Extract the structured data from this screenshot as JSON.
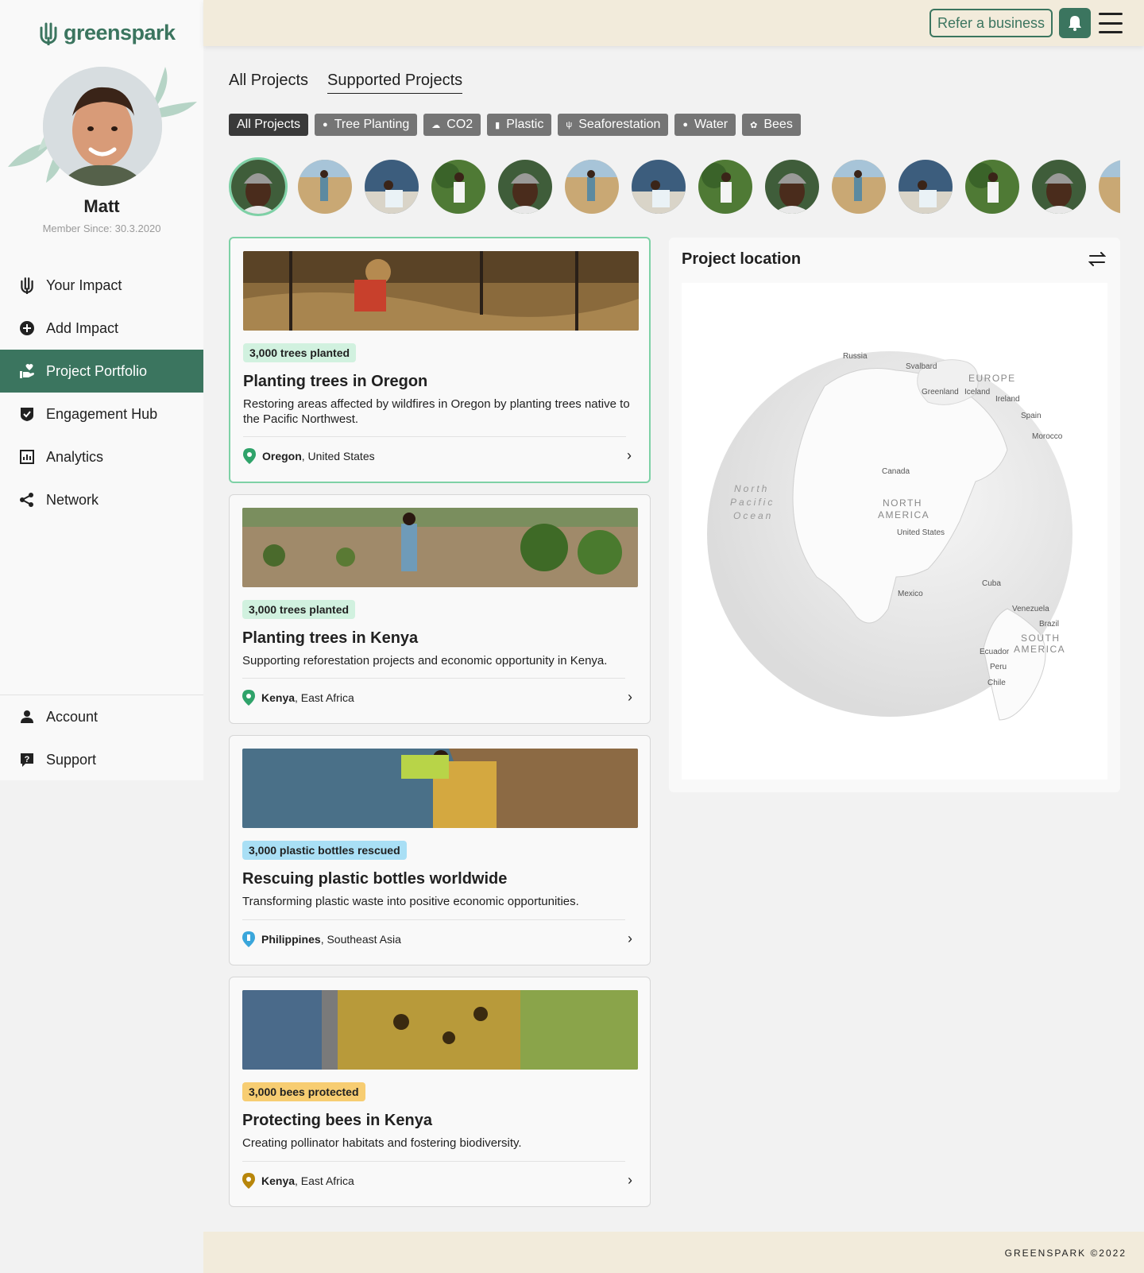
{
  "brand": {
    "name": "greenspark"
  },
  "user": {
    "name": "Matt",
    "member_since": "Member Since: 30.3.2020"
  },
  "nav": {
    "items": [
      {
        "label": "Your Impact",
        "icon": "hand-leaf-icon"
      },
      {
        "label": "Add Impact",
        "icon": "plus-circle-icon"
      },
      {
        "label": "Project Portfolio",
        "icon": "hand-heart-icon",
        "active": true
      },
      {
        "label": "Engagement Hub",
        "icon": "shield-check-icon"
      },
      {
        "label": "Analytics",
        "icon": "bar-chart-icon"
      },
      {
        "label": "Network",
        "icon": "share-icon"
      }
    ],
    "bottom": [
      {
        "label": "Account",
        "icon": "person-icon"
      },
      {
        "label": "Support",
        "icon": "help-icon"
      }
    ]
  },
  "header": {
    "refer_label": "Refer a business"
  },
  "tabs": [
    {
      "label": "All Projects",
      "active": false
    },
    {
      "label": "Supported Projects",
      "active": true
    }
  ],
  "filters": [
    {
      "label": "All Projects",
      "icon": "",
      "active": true
    },
    {
      "label": "Tree Planting",
      "icon": "tree-icon"
    },
    {
      "label": "CO2",
      "icon": "cloud-icon"
    },
    {
      "label": "Plastic",
      "icon": "bottle-icon"
    },
    {
      "label": "Seaforestation",
      "icon": "seaweed-icon"
    },
    {
      "label": "Water",
      "icon": "drop-icon"
    },
    {
      "label": "Bees",
      "icon": "bee-icon"
    }
  ],
  "projects": [
    {
      "badge": "3,000 trees planted",
      "title": "Planting trees in Oregon",
      "desc": "Restoring areas affected by wildfires in Oregon by planting trees native to the Pacific Northwest.",
      "loc_bold": "Oregon",
      "loc_rest": ", United States"
    },
    {
      "badge": "3,000 trees planted",
      "title": "Planting trees in Kenya",
      "desc": "Supporting reforestation projects and economic opportunity in Kenya.",
      "loc_bold": "Kenya",
      "loc_rest": ", East Africa"
    },
    {
      "badge": "3,000 plastic bottles rescued",
      "title": "Rescuing plastic bottles worldwide",
      "desc": "Transforming plastic waste into positive economic opportunities.",
      "loc_bold": "Philippines",
      "loc_rest": ", Southeast Asia"
    },
    {
      "badge": "3,000 bees protected",
      "title": "Protecting bees in Kenya",
      "desc": "Creating pollinator habitats and fostering biodiversity.",
      "loc_bold": "Kenya",
      "loc_rest": ", East Africa"
    }
  ],
  "map": {
    "title": "Project location",
    "labels": {
      "russia": "Russia",
      "svalbard": "Svalbard",
      "europe": "EUROPE",
      "greenland": "Greenland",
      "iceland": "Iceland",
      "ireland": "Ireland",
      "spain": "Spain",
      "morocco": "Morocco",
      "canada": "Canada",
      "north_pacific_1": "North",
      "north_pacific_2": "Pacific",
      "north_pacific_3": "Ocean",
      "north_america_1": "NORTH",
      "north_america_2": "AMERICA",
      "united_states": "United States",
      "cuba": "Cuba",
      "mexico": "Mexico",
      "venezuela": "Venezuela",
      "brazil": "Brazil",
      "south_america_1": "SOUTH",
      "south_america_2": "AMERICA",
      "ecuador": "Ecuador",
      "peru": "Peru",
      "chile": "Chile"
    }
  },
  "footer": {
    "text": "GREENSPARK ©2022"
  },
  "colors": {
    "brand": "#3b755f",
    "selected": "#7ed1a6",
    "header_bg": "#f2ebdb"
  }
}
